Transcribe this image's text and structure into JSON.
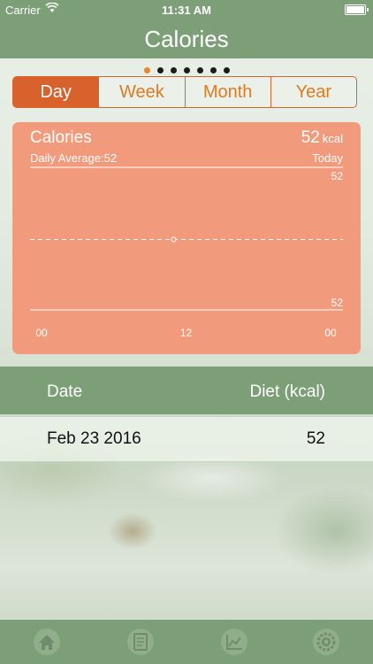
{
  "status_bar": {
    "carrier": "Carrier",
    "time": "11:31 AM",
    "battery_level": 1.0
  },
  "nav": {
    "title": "Calories"
  },
  "page_indicator": {
    "count": 7,
    "active_index": 0,
    "active_color": "#e58a2b"
  },
  "segments": [
    {
      "label": "Day",
      "active": true
    },
    {
      "label": "Week",
      "active": false
    },
    {
      "label": "Month",
      "active": false
    },
    {
      "label": "Year",
      "active": false
    }
  ],
  "chart_card": {
    "title": "Calories",
    "value": "52",
    "unit": "kcal",
    "daily_average": "Daily Average:52",
    "period": "Today"
  },
  "chart_data": {
    "type": "line",
    "title": "",
    "x_tick_labels": [
      "00",
      "12",
      "00"
    ],
    "y_tick_labels": [
      "52",
      "52"
    ],
    "average_line": 52,
    "series": [
      {
        "x": [
          "12"
        ],
        "y": [
          52
        ]
      }
    ],
    "ylim": [
      52,
      52
    ],
    "grid": false
  },
  "table": {
    "headers": {
      "date": "Date",
      "diet": "Diet (kcal)"
    },
    "rows": [
      {
        "date": "Feb 23 2016",
        "value": "52"
      }
    ]
  },
  "tab_bar": {
    "items": [
      {
        "icon": "home-icon"
      },
      {
        "icon": "document-icon"
      },
      {
        "icon": "chart-icon"
      },
      {
        "icon": "settings-icon"
      }
    ]
  },
  "colors": {
    "header_green": "#7d9f78",
    "accent_orange": "#d9622c",
    "card_salmon": "#f29b7c"
  }
}
